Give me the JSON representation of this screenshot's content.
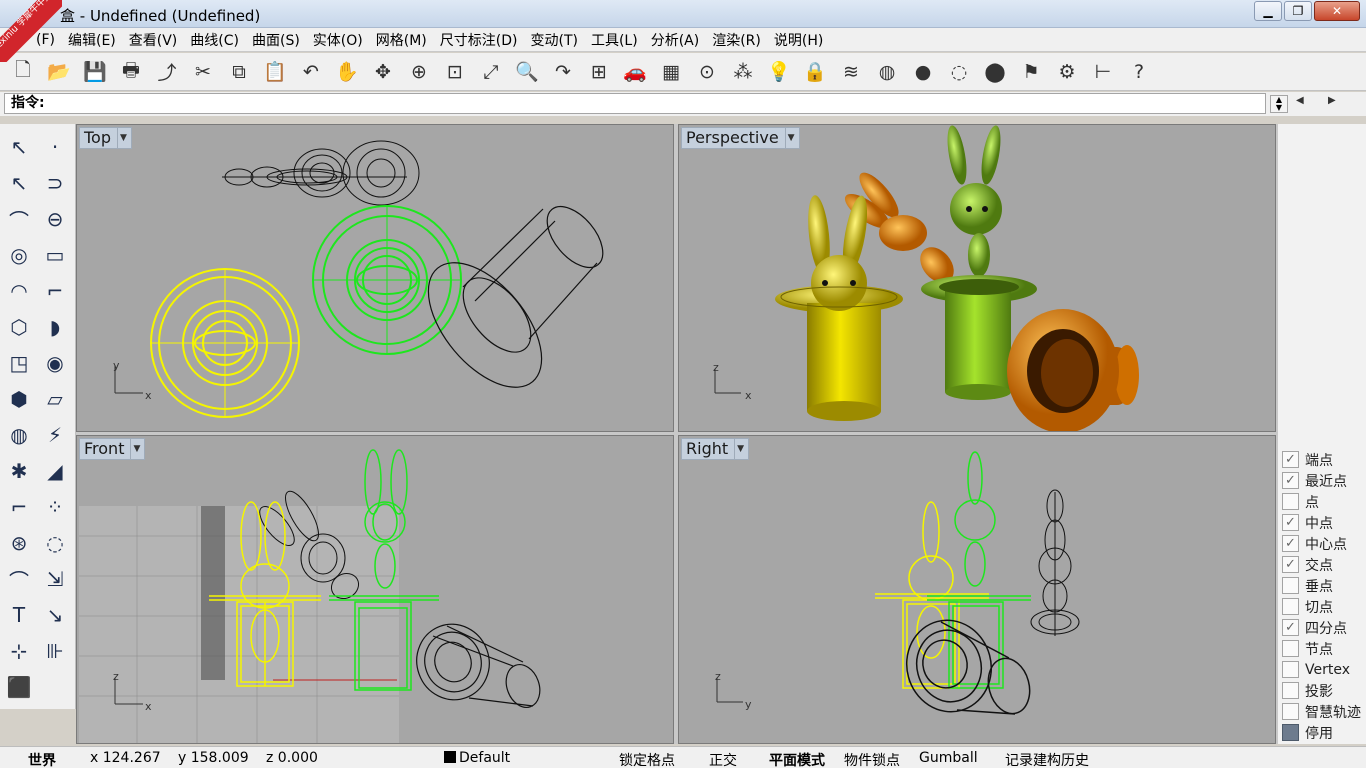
{
  "window": {
    "title": "盒 - Undefined (Undefined)",
    "logo_text": "xuexiniu 学犀牛中文网",
    "buttons": [
      "minimize",
      "restore",
      "close"
    ]
  },
  "menu": [
    {
      "label": "(F)"
    },
    {
      "label": "编辑(E)"
    },
    {
      "label": "查看(V)"
    },
    {
      "label": "曲线(C)"
    },
    {
      "label": "曲面(S)"
    },
    {
      "label": "实体(O)"
    },
    {
      "label": "网格(M)"
    },
    {
      "label": "尺寸标注(D)"
    },
    {
      "label": "变动(T)"
    },
    {
      "label": "工具(L)"
    },
    {
      "label": "分析(A)"
    },
    {
      "label": "渲染(R)"
    },
    {
      "label": "说明(H)"
    }
  ],
  "toolbar": {
    "icons": [
      "new-file-icon",
      "open-icon",
      "save-icon",
      "print-icon",
      "import-icon",
      "cut-icon",
      "copy-icon",
      "paste-icon",
      "undo-icon",
      "pan-hand-icon",
      "rotate-view-icon",
      "zoom-icon",
      "zoom-window-icon",
      "zoom-extents-icon",
      "zoom-selected-icon",
      "undo-view-icon",
      "four-viewports-icon",
      "car-icon",
      "grid-plane-icon",
      "cplane-icon",
      "points-icon",
      "light-icon",
      "lock-icon",
      "layers-icon",
      "color-wheel-icon",
      "shade-icon",
      "wire-sphere-icon",
      "render-sphere-icon",
      "flag-icon",
      "settings-gear-icon",
      "dimension-icon",
      "help-icon"
    ],
    "glyphs": [
      "🗋",
      "📂",
      "💾",
      "🖶",
      "⤴",
      "✂",
      "⧉",
      "📋",
      "↶",
      "✋",
      "✥",
      "⊕",
      "⊡",
      "⤢",
      "🔍",
      "↷",
      "⊞",
      "🚗",
      "▦",
      "⊙",
      "⁂",
      "💡",
      "🔒",
      "≋",
      "◍",
      "●",
      "◌",
      "⬤",
      "⚑",
      "⚙",
      "⊢",
      "?"
    ]
  },
  "command": {
    "prompt": "指令:",
    "value": ""
  },
  "palette": {
    "col1": [
      "↖",
      "↖",
      "⌒",
      "◎",
      "◠",
      "⬡",
      "◳",
      "⬢",
      "◍",
      "✱",
      "⌐",
      "⊛",
      "⌒",
      "T",
      "⊹",
      "⬛"
    ],
    "col2": [
      "·",
      "⊃",
      "⊖",
      "▭",
      "⌐",
      "◗",
      "◉",
      "▱",
      "⚡",
      "◢",
      "⁘",
      "◌",
      "⇲",
      "↘",
      "⊪",
      ""
    ]
  },
  "viewports": [
    {
      "id": "top",
      "label": "Top",
      "axis_h": "x",
      "axis_v": "y"
    },
    {
      "id": "perspective",
      "label": "Perspective",
      "axis_h": "x",
      "axis_v": "z"
    },
    {
      "id": "front",
      "label": "Front",
      "axis_h": "x",
      "axis_v": "z"
    },
    {
      "id": "right",
      "label": "Right",
      "axis_h": "y",
      "axis_v": "z"
    }
  ],
  "colors": {
    "viewport_bg": "#a6a6a6",
    "wire_yellow": "#f5f500",
    "wire_green": "#1ee61e",
    "wire_black": "#111111",
    "shade_yellow": "#e3d300",
    "shade_green": "#7fc41a",
    "shade_orange": "#e67e00"
  },
  "osnap": [
    {
      "label": "端点",
      "checked": true
    },
    {
      "label": "最近点",
      "checked": true
    },
    {
      "label": "点",
      "checked": false
    },
    {
      "label": "中点",
      "checked": true
    },
    {
      "label": "中心点",
      "checked": true
    },
    {
      "label": "交点",
      "checked": true
    },
    {
      "label": "垂点",
      "checked": false
    },
    {
      "label": "切点",
      "checked": false
    },
    {
      "label": "四分点",
      "checked": true
    },
    {
      "label": "节点",
      "checked": false
    },
    {
      "label": "Vertex",
      "checked": false
    },
    {
      "label": "投影",
      "checked": false
    },
    {
      "label": "智慧轨迹",
      "checked": false
    },
    {
      "label": "停用",
      "checked": false
    }
  ],
  "status": {
    "cplane": "世界",
    "x": "x 124.267",
    "y": "y 158.009",
    "z": "z 0.000",
    "layer": "Default",
    "grid_snap": "锁定格点",
    "ortho": "正交",
    "planar": "平面模式",
    "osnap": "物件锁点",
    "gumball": "Gumball",
    "history": "记录建构历史"
  }
}
